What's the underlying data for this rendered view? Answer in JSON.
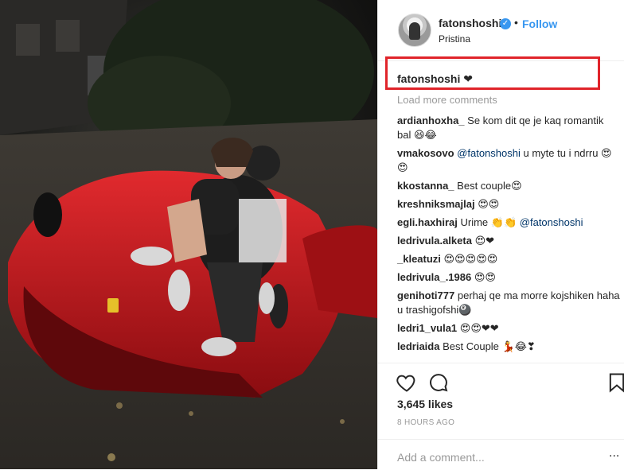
{
  "post": {
    "username": "fatonshoshi",
    "verified_icon": "verified-badge-icon",
    "separator": "•",
    "follow_label": "Follow",
    "location": "Pristina",
    "caption_user": "fatonshoshi",
    "caption_text": "❤",
    "load_more": "Load more comments",
    "comments": [
      {
        "user": "ardianhoxha_",
        "text": "Se kom dit qe je kaq romantik bal 😆😂"
      },
      {
        "user": "vmakosovo",
        "mention": "@fatonshoshi",
        "text": "u myte tu i ndrru 😍😍"
      },
      {
        "user": "kkostanna_",
        "text": "Best couple😍"
      },
      {
        "user": "kreshniksmajlaj",
        "text": "😍😍"
      },
      {
        "user": "egli.haxhiraj",
        "text": "Urime 👏👏",
        "mention": "@fatonshoshi"
      },
      {
        "user": "ledrivula.alketa",
        "text": "😍❤"
      },
      {
        "user": "_kleatuzi",
        "text": "😍😍😍😍😍"
      },
      {
        "user": "ledrivula_.1986",
        "text": "😍😍"
      },
      {
        "user": "genihoti777",
        "text": "perhaj qe ma morre kojshiken haha u trashigofshi🎱"
      },
      {
        "user": "ledri1_vula1",
        "text": "😍😍❤❤"
      },
      {
        "user": "ledriaida",
        "text": "Best Couple 💃😂❣"
      }
    ],
    "likes": "3,645 likes",
    "time": "8 HOURS AGO",
    "add_comment_placeholder": "Add a comment...",
    "more_options": "..."
  },
  "icons": {
    "like": "heart-icon",
    "comment": "comment-icon",
    "save": "bookmark-icon"
  },
  "colors": {
    "accent": "#3897f0",
    "highlight_box": "#e0242a",
    "car": "#c0141a"
  }
}
